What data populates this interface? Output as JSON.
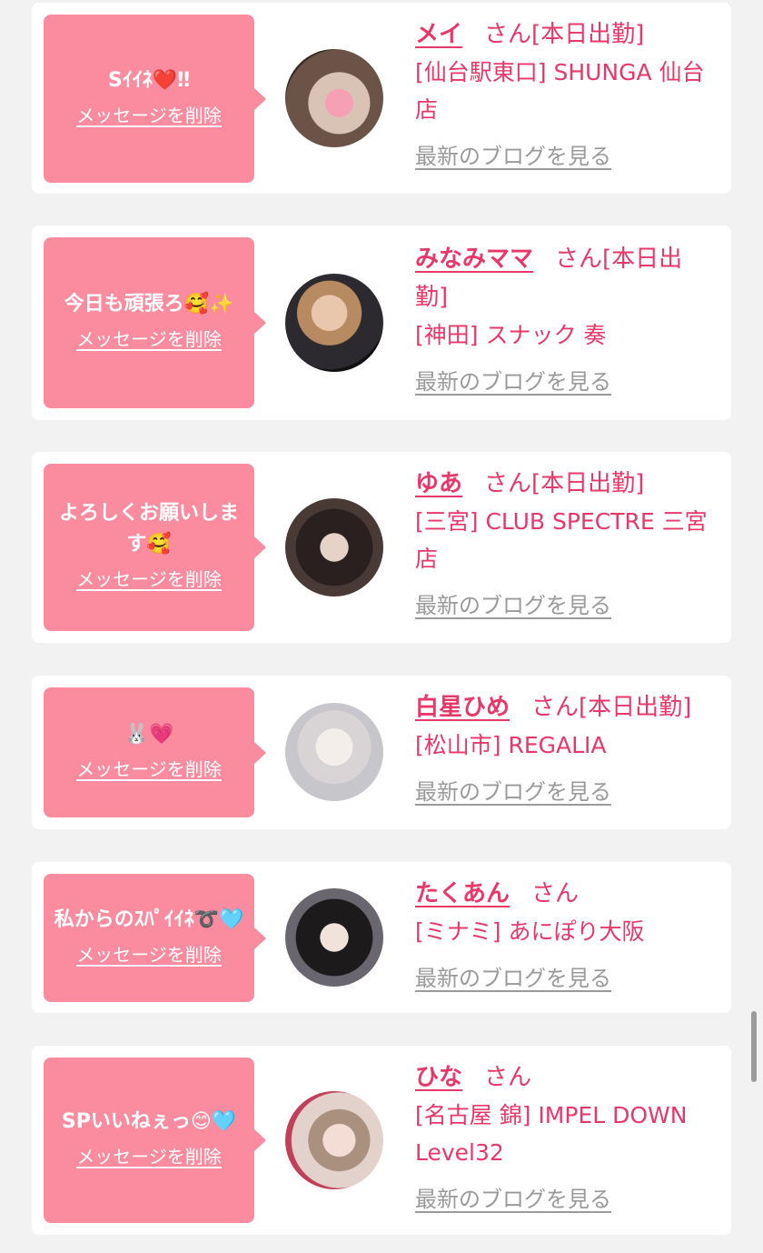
{
  "delete_label": "メッセージを削除",
  "blog_label": "最新のブログを見る",
  "san_label": "さん",
  "cards": [
    {
      "message": "Sｲｲﾈ❤️‼",
      "name": "メイ",
      "status": "[本日出勤]",
      "shop": "[仙台駅東口] SHUNGA 仙台店",
      "avatar_icon": "avatar-photo"
    },
    {
      "message": "今日も頑張ろ🥰✨",
      "name": "みなみママ",
      "status": "[本日出勤]",
      "shop": "[神田] スナック 奏",
      "avatar_icon": "avatar-photo"
    },
    {
      "message": "よろしくお願いします🥰",
      "name": "ゆあ",
      "status": "[本日出勤]",
      "shop": "[三宮] CLUB SPECTRE 三宮店",
      "avatar_icon": "avatar-photo"
    },
    {
      "message": "🐰💗",
      "name": "白星ひめ",
      "status": "[本日出勤]",
      "shop": "[松山市] REGALIA",
      "avatar_icon": "avatar-photo"
    },
    {
      "message": "私からのｽﾊﾟｲｲﾈ➰🩵",
      "name": "たくあん",
      "status": "",
      "shop": "[ミナミ] あにぽり大阪",
      "avatar_icon": "avatar-photo"
    },
    {
      "message": "SPいいねぇっ😊🩵",
      "name": "ひな",
      "status": "",
      "shop": "[名古屋 錦] IMPEL DOWN Level32",
      "avatar_icon": "avatar-photo"
    }
  ],
  "colors": {
    "accent": "#e8386a",
    "bubble": "#fb8c9f",
    "muted": "#9a9a9a",
    "background": "#f2f2f2"
  }
}
